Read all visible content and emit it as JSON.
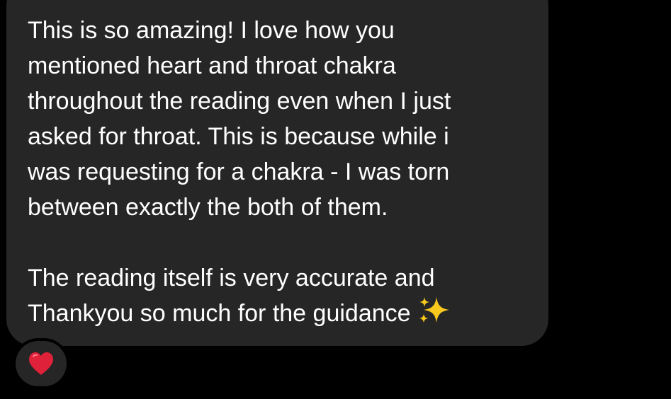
{
  "message": {
    "lines_paragraph_1": [
      "This is so amazing! I love how you",
      "mentioned heart and throat chakra",
      "throughout the reading even when I just",
      "asked for throat. This is because while i",
      "was requesting for a chakra - I was torn",
      "between exactly the both of them."
    ],
    "lines_paragraph_2": [
      "The reading itself is very accurate and",
      "Thankyou so much for the guidance"
    ],
    "trailing_emoji": "sparkles-icon",
    "bubble_color": "#262626"
  },
  "reaction": {
    "icon": "heart-icon",
    "color": "#e0213a"
  }
}
